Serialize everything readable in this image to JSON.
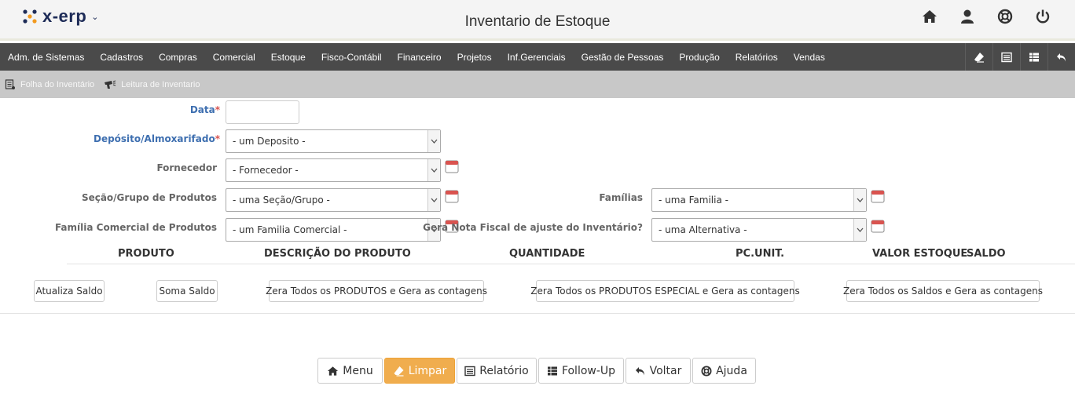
{
  "app": {
    "logo_text": "x-erp",
    "title": "Inventario de Estoque"
  },
  "top_icons": [
    "home-icon",
    "user-icon",
    "lifebuoy-icon",
    "power-icon"
  ],
  "menu": [
    "Adm. de Sistemas",
    "Cadastros",
    "Compras",
    "Comercial",
    "Estoque",
    "Fisco-Contábil",
    "Financeiro",
    "Projetos",
    "Inf.Gerenciais",
    "Gestão de Pessoas",
    "Produção",
    "Relatórios",
    "Vendas"
  ],
  "menu_tools": [
    "eraser-icon",
    "list-alt-icon",
    "table-icon",
    "undo-icon"
  ],
  "subnav": {
    "folha": "Folha do Inventário",
    "leitura": "Leitura de Inventario"
  },
  "form": {
    "data_label": "Data",
    "deposito_label": "Depósito/Almoxarifado",
    "deposito_value": "- um Deposito -",
    "fornecedor_label": "Fornecedor",
    "fornecedor_value": "- Fornecedor -",
    "secao_label": "Seção/Grupo de Produtos",
    "secao_value": "- uma Seção/Grupo -",
    "familias_label": "Famílias",
    "familias_value": "- uma Familia -",
    "familia_com_label": "Família Comercial de Produtos",
    "familia_com_value": "- um Familia Comercial -",
    "gera_nf_label": "Gera Nota Fiscal de ajuste do Inventário?",
    "gera_nf_value": "- uma Alternativa -",
    "required_mark": "*"
  },
  "columns": [
    "PRODUTO",
    "DESCRIÇÃO DO PRODUTO",
    "QUANTIDADE",
    "PC.UNIT.",
    "VALOR ESTOQUE",
    "SALDO"
  ],
  "actions": {
    "atualiza": "Atualiza Saldo",
    "soma": "Soma Saldo",
    "zera_produtos": "Zera Todos os PRODUTOS e Gera as contagens",
    "zera_especial": "Zera Todos os PRODUTOS ESPECIAL e Gera as contagens",
    "zera_saldos": "Zera Todos os Saldos e Gera as contagens"
  },
  "bottom": {
    "menu": "Menu",
    "limpar": "Limpar",
    "relatorio": "Relatório",
    "followup": "Follow-Up",
    "voltar": "Voltar",
    "ajuda": "Ajuda"
  },
  "colors": {
    "menubar": "#4a4a4a",
    "label_blue": "#3e6fb0",
    "warn": "#f0ad4e"
  }
}
